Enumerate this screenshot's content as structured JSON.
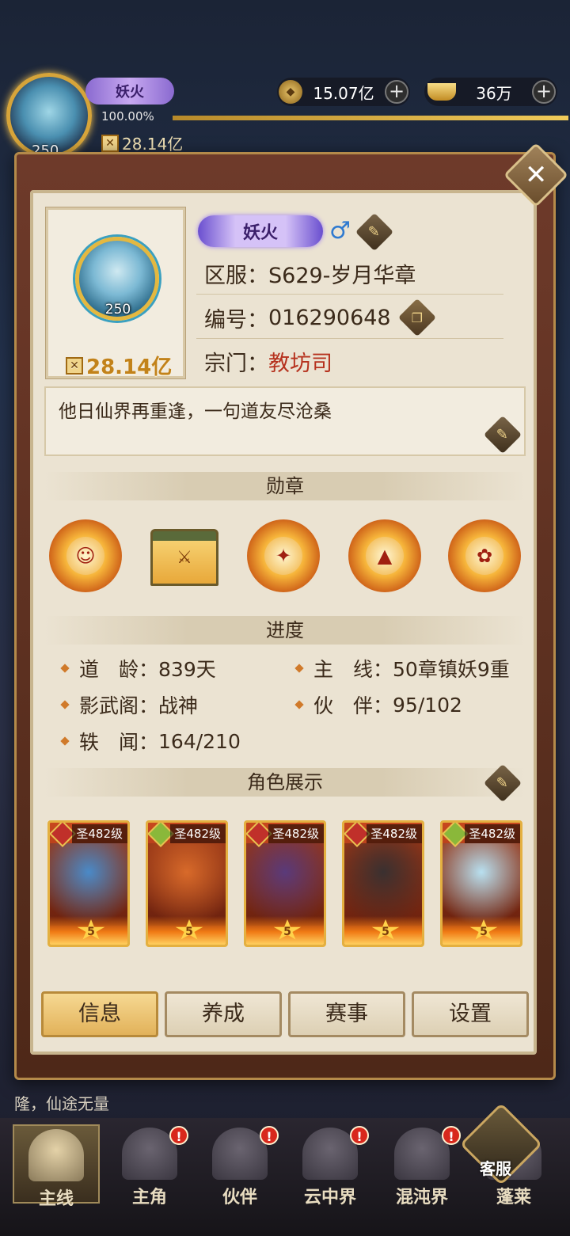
{
  "hud": {
    "title_badge": "妖火",
    "level": "250",
    "exp_percent": "100.00%",
    "exp_fill": 1.0,
    "power": "28.14亿",
    "coins": "15.07亿",
    "gold": "36万",
    "plus": "+"
  },
  "profile": {
    "title_badge": "妖火",
    "gender": "♂",
    "level": "250",
    "power": "28.14亿",
    "server_label": "区服：",
    "server_value": "S629-岁月华章",
    "id_label": "编号：",
    "id_value": "016290648",
    "sect_label": "宗门：",
    "sect_value": "教坊司",
    "signature": "他日仙界再重逢，一句道友尽沧桑"
  },
  "sections": {
    "medals": "勋章",
    "progress": "进度",
    "showcase": "角色展示"
  },
  "stats": {
    "age_label": "道　龄：",
    "age_value": "839天",
    "main_label": "主　线：",
    "main_value": "50章镇妖9重",
    "shadow_label": "影武阁：",
    "shadow_value": "战神",
    "partner_label": "伙　伴：",
    "partner_value": "95/102",
    "lore_label": "轶　闻：",
    "lore_value": "164/210"
  },
  "heroes": [
    {
      "level": "圣482级",
      "stars": "5",
      "gem_color": "#c0302a",
      "color": "#4a8ac8"
    },
    {
      "level": "圣482级",
      "stars": "5",
      "gem_color": "#8ab83a",
      "color": "#d86a2a"
    },
    {
      "level": "圣482级",
      "stars": "5",
      "gem_color": "#c0302a",
      "color": "#5a3a7a"
    },
    {
      "level": "圣482级",
      "stars": "5",
      "gem_color": "#c0302a",
      "color": "#3a3030"
    },
    {
      "level": "圣482级",
      "stars": "5",
      "gem_color": "#8ab83a",
      "color": "#b8e0f0"
    }
  ],
  "tabs": {
    "info": "信息",
    "train": "养成",
    "event": "赛事",
    "settings": "设置"
  },
  "chat": "隆，仙途无量",
  "nav": {
    "main": "主线",
    "hero": "主角",
    "partner": "伙伴",
    "cloud": "云中界",
    "chaos": "混沌界",
    "penglai": "蓬莱",
    "service": "客服",
    "badge": "!"
  },
  "colors": {
    "accent_gold": "#e4b040",
    "sect_red": "#b6321e",
    "gender_blue": "#2f7ad0"
  }
}
